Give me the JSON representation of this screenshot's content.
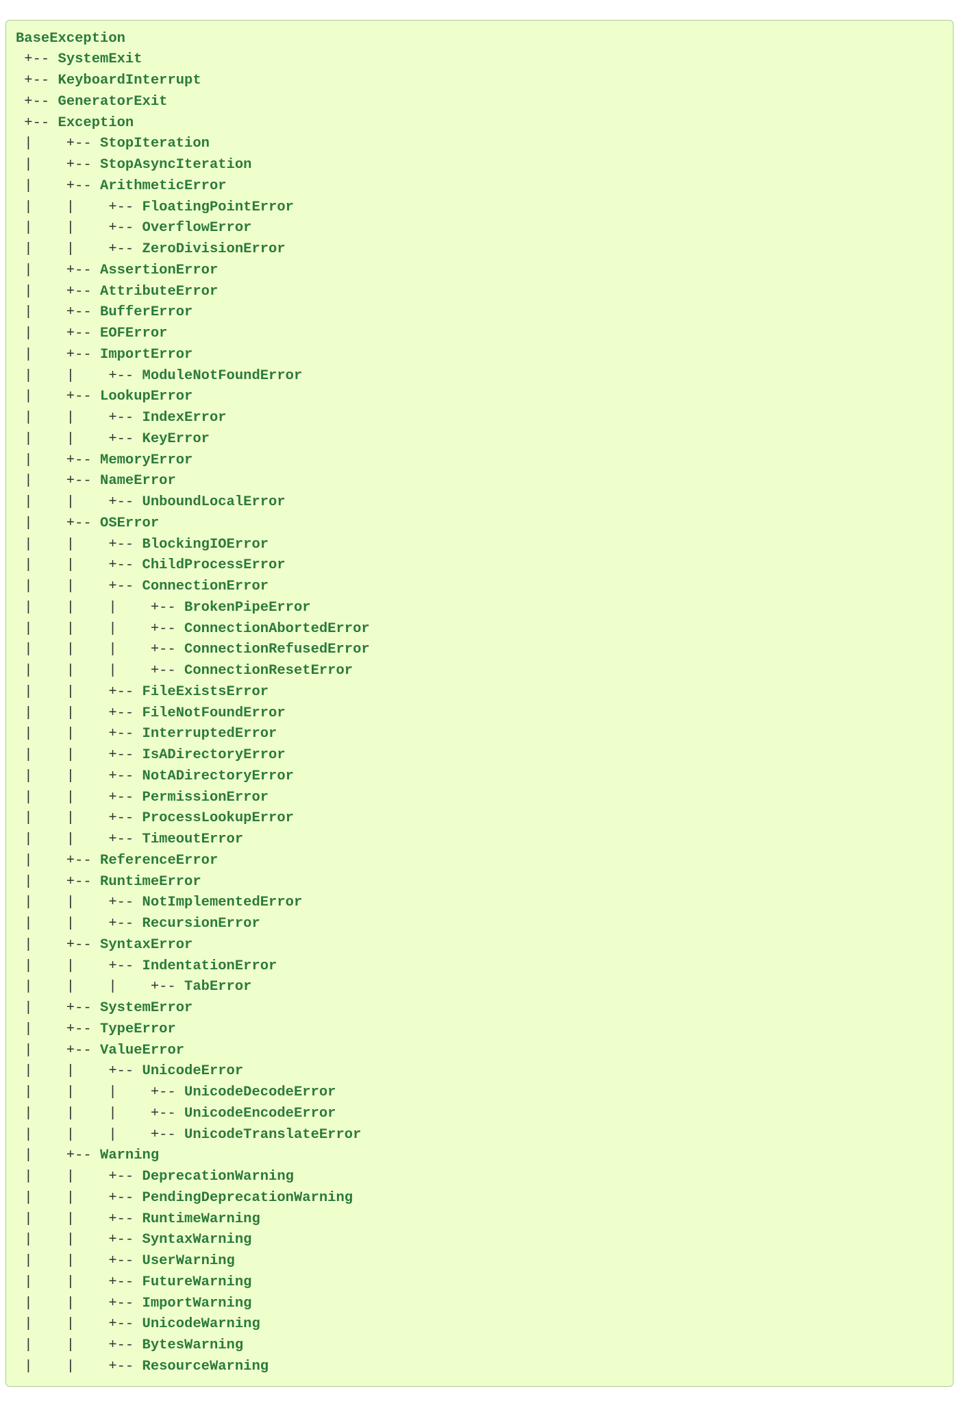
{
  "tree": {
    "name": "BaseException",
    "children": [
      {
        "name": "SystemExit"
      },
      {
        "name": "KeyboardInterrupt"
      },
      {
        "name": "GeneratorExit"
      },
      {
        "name": "Exception",
        "children": [
          {
            "name": "StopIteration"
          },
          {
            "name": "StopAsyncIteration"
          },
          {
            "name": "ArithmeticError",
            "children": [
              {
                "name": "FloatingPointError"
              },
              {
                "name": "OverflowError"
              },
              {
                "name": "ZeroDivisionError"
              }
            ]
          },
          {
            "name": "AssertionError"
          },
          {
            "name": "AttributeError"
          },
          {
            "name": "BufferError"
          },
          {
            "name": "EOFError"
          },
          {
            "name": "ImportError",
            "children": [
              {
                "name": "ModuleNotFoundError"
              }
            ]
          },
          {
            "name": "LookupError",
            "children": [
              {
                "name": "IndexError"
              },
              {
                "name": "KeyError"
              }
            ]
          },
          {
            "name": "MemoryError"
          },
          {
            "name": "NameError",
            "children": [
              {
                "name": "UnboundLocalError"
              }
            ]
          },
          {
            "name": "OSError",
            "children": [
              {
                "name": "BlockingIOError"
              },
              {
                "name": "ChildProcessError"
              },
              {
                "name": "ConnectionError",
                "children": [
                  {
                    "name": "BrokenPipeError"
                  },
                  {
                    "name": "ConnectionAbortedError"
                  },
                  {
                    "name": "ConnectionRefusedError"
                  },
                  {
                    "name": "ConnectionResetError"
                  }
                ]
              },
              {
                "name": "FileExistsError"
              },
              {
                "name": "FileNotFoundError"
              },
              {
                "name": "InterruptedError"
              },
              {
                "name": "IsADirectoryError"
              },
              {
                "name": "NotADirectoryError"
              },
              {
                "name": "PermissionError"
              },
              {
                "name": "ProcessLookupError"
              },
              {
                "name": "TimeoutError"
              }
            ]
          },
          {
            "name": "ReferenceError"
          },
          {
            "name": "RuntimeError",
            "children": [
              {
                "name": "NotImplementedError"
              },
              {
                "name": "RecursionError"
              }
            ]
          },
          {
            "name": "SyntaxError",
            "children": [
              {
                "name": "IndentationError",
                "children": [
                  {
                    "name": "TabError"
                  }
                ]
              }
            ]
          },
          {
            "name": "SystemError"
          },
          {
            "name": "TypeError"
          },
          {
            "name": "ValueError",
            "children": [
              {
                "name": "UnicodeError",
                "children": [
                  {
                    "name": "UnicodeDecodeError"
                  },
                  {
                    "name": "UnicodeEncodeError"
                  },
                  {
                    "name": "UnicodeTranslateError"
                  }
                ]
              }
            ]
          },
          {
            "name": "Warning",
            "children": [
              {
                "name": "DeprecationWarning"
              },
              {
                "name": "PendingDeprecationWarning"
              },
              {
                "name": "RuntimeWarning"
              },
              {
                "name": "SyntaxWarning"
              },
              {
                "name": "UserWarning"
              },
              {
                "name": "FutureWarning"
              },
              {
                "name": "ImportWarning"
              },
              {
                "name": "UnicodeWarning"
              },
              {
                "name": "BytesWarning"
              },
              {
                "name": "ResourceWarning"
              }
            ]
          }
        ]
      }
    ]
  }
}
